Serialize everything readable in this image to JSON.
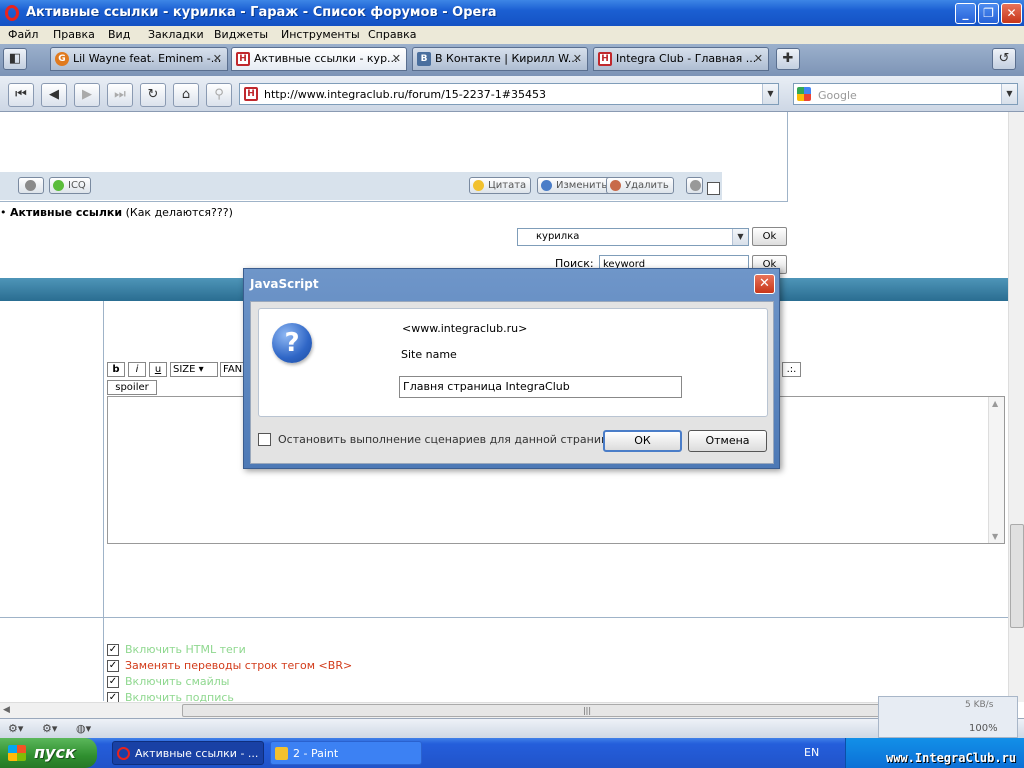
{
  "window": {
    "title": "Активные ссылки - курилка - Гараж - Список форумов - Opera",
    "buttons": [
      "_",
      "❐",
      "✕"
    ]
  },
  "menu": [
    "Файл",
    "Правка",
    "Вид",
    "Закладки",
    "Виджеты",
    "Инструменты",
    "Справка"
  ],
  "tabs": [
    {
      "label": "Lil Wayne feat. Eminem -...",
      "icon": "orange-favicon"
    },
    {
      "label": "Активные ссылки - кур...",
      "icon": "honda-favicon",
      "active": true
    },
    {
      "label": "В Контакте | Кирилл W...",
      "icon": "vk-favicon"
    },
    {
      "label": "Integra Club - Главная ...",
      "icon": "honda-favicon"
    }
  ],
  "address": {
    "url": "http://www.integraclub.ru/forum/15-2237-1#35453",
    "search_placeholder": "Google"
  },
  "post_toolbar": {
    "icq": "ICQ",
    "quote": "Цитата",
    "edit": "Изменить",
    "delete": "Удалить"
  },
  "thread": {
    "title": "Активные ссылки",
    "subtitle": "(Как делаются???)",
    "forum_select": "курилка",
    "ok": "Ok",
    "search_label": "Поиск:",
    "search_value": "keyword"
  },
  "editor": {
    "bold": "b",
    "italic": "i",
    "underline": "u",
    "size": "SIZE",
    "font": "FAN",
    "spoiler": "spoiler",
    "more": ".:."
  },
  "options": [
    {
      "label": "Включить HTML теги",
      "checked": true,
      "color": "#8fd88f"
    },
    {
      "label": "Заменять переводы строк тегом <BR>",
      "checked": true,
      "color": "#d23b1a"
    },
    {
      "label": "Включить смайлы",
      "checked": true,
      "color": "#8fd88f"
    },
    {
      "label": "Включить подпись",
      "checked": true,
      "color": "#8fd88f"
    }
  ],
  "statusbar": {
    "speed": "5 KB/s",
    "zoom": "100%"
  },
  "dialog": {
    "title": "JavaScript",
    "origin": "<www.integraclub.ru>",
    "prompt": "Site name",
    "input_value": "Главня страница IntegraClub",
    "stop_scripts": "Остановить выполнение сценариев для данной страницы",
    "ok": "ОК",
    "cancel": "Отмена"
  },
  "taskbar": {
    "start": "пуск",
    "items": [
      {
        "label": "Активные ссылки - ...",
        "active": true
      },
      {
        "label": "2 - Paint",
        "active": false
      }
    ],
    "lang": "EN",
    "watermark": "www.IntegraClub.ru"
  },
  "colors": {
    "accent": "#2a6d91",
    "dialog_frame": "#4d79b6"
  }
}
